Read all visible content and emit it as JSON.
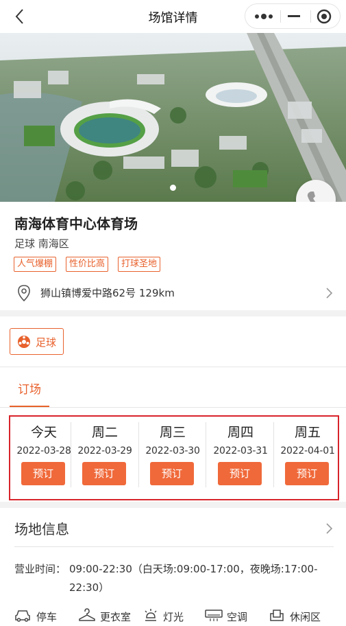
{
  "navbar": {
    "title": "场馆详情"
  },
  "hero": {
    "image_alt": "体育中心鸟瞰效果图",
    "slide_count": 1,
    "active_slide": 1
  },
  "venue": {
    "name": "南海体育中心体育场",
    "sport": "足球",
    "district": "南海区",
    "tags": [
      "人气爆棚",
      "性价比高",
      "打球圣地"
    ],
    "address": "狮山镇博爱中路62号",
    "distance": "129km"
  },
  "sport_selector": {
    "label": "足球"
  },
  "tabs": {
    "active": "订场"
  },
  "dates": [
    {
      "day": "今天",
      "date": "2022-03-28",
      "button": "预订"
    },
    {
      "day": "周二",
      "date": "2022-03-29",
      "button": "预订"
    },
    {
      "day": "周三",
      "date": "2022-03-30",
      "button": "预订"
    },
    {
      "day": "周四",
      "date": "2022-03-31",
      "button": "预订"
    },
    {
      "day": "周五",
      "date": "2022-04-01",
      "button": "预订"
    }
  ],
  "info": {
    "title": "场地信息",
    "hours_label": "营业时间：",
    "hours_value": "09:00-22:30（白天场:09:00-17:00，夜晚场:17:00-22:30）",
    "amenities": [
      {
        "label": "停车",
        "icon": "car-icon"
      },
      {
        "label": "更衣室",
        "icon": "hanger-icon"
      },
      {
        "label": "灯光",
        "icon": "lamp-icon"
      },
      {
        "label": "空调",
        "icon": "air-conditioner-icon"
      },
      {
        "label": "休闲区",
        "icon": "sofa-icon"
      }
    ]
  },
  "colors": {
    "accent": "#e8612c",
    "button": "#f0693a",
    "highlight_border": "#d8232a"
  }
}
